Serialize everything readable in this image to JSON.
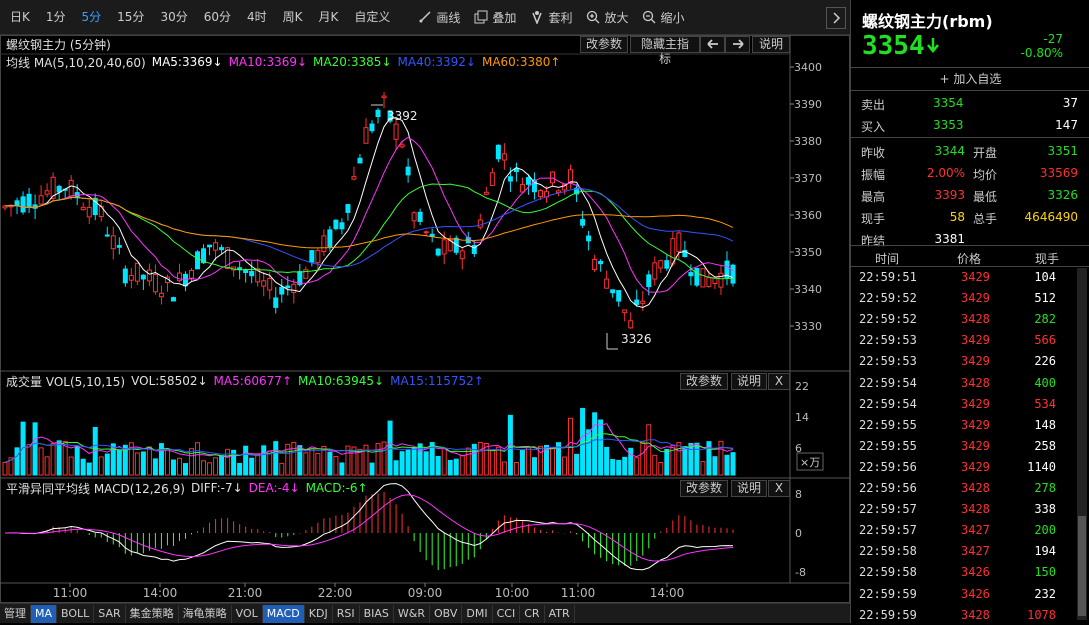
{
  "toolbar": {
    "periods": [
      "日K",
      "1分",
      "5分",
      "15分",
      "30分",
      "60分",
      "4时",
      "周K",
      "月K",
      "自定义"
    ],
    "active_period": "5分",
    "tools": [
      {
        "label": "画线",
        "icon": "draw-line-icon"
      },
      {
        "label": "叠加",
        "icon": "overlay-icon"
      },
      {
        "label": "套利",
        "icon": "arbitrage-icon"
      },
      {
        "label": "放大",
        "icon": "zoom-in-icon"
      },
      {
        "label": "缩小",
        "icon": "zoom-out-icon"
      }
    ]
  },
  "main_panel": {
    "title": "螺纹钢主力 (5分钟)",
    "buttons": [
      "改参数",
      "隐藏主指标",
      "说明"
    ],
    "indicator_line": [
      {
        "text": "均线 MA(5,10,20,40,60)",
        "color": "#e0e0e0"
      },
      {
        "text": "MA5:3369↓",
        "color": "#ffffff"
      },
      {
        "text": "MA10:3369↓",
        "color": "#ff33ff"
      },
      {
        "text": "MA20:3385↓",
        "color": "#33ff33"
      },
      {
        "text": "MA40:3392↓",
        "color": "#3355ff"
      },
      {
        "text": "MA60:3380↑",
        "color": "#ff9900"
      }
    ],
    "y_ticks": [
      "3400",
      "3390",
      "3380",
      "3370",
      "3360",
      "3350",
      "3340",
      "3330"
    ],
    "high_label": "3392",
    "low_label": "3326"
  },
  "volume_panel": {
    "indicator_line": [
      {
        "text": "成交量 VOL(5,10,15)",
        "color": "#e0e0e0"
      },
      {
        "text": "VOL:58502↓",
        "color": "#e0e0e0"
      },
      {
        "text": "MA5:60677↑",
        "color": "#ff33ff"
      },
      {
        "text": "MA10:63945↓",
        "color": "#33ff33"
      },
      {
        "text": "MA15:115752↑",
        "color": "#3355ff"
      }
    ],
    "buttons": [
      "改参数",
      "说明",
      "X"
    ],
    "y_ticks": [
      "22",
      "14",
      "6"
    ],
    "unit": "×万"
  },
  "macd_panel": {
    "indicator_line": [
      {
        "text": "平滑异同平均线 MACD(12,26,9)",
        "color": "#e0e0e0"
      },
      {
        "text": "DIFF:-7↓",
        "color": "#e0e0e0"
      },
      {
        "text": "DEA:-4↓",
        "color": "#ff33ff"
      },
      {
        "text": "MACD:-6↑",
        "color": "#33ff33"
      }
    ],
    "buttons": [
      "改参数",
      "说明",
      "X"
    ],
    "y_ticks": [
      "8",
      "0",
      "-8"
    ]
  },
  "x_axis": [
    "11:00",
    "14:00",
    "21:00",
    "22:00",
    "09:00",
    "10:00",
    "11:00",
    "14:00"
  ],
  "bottom_tabs": [
    "管理",
    "MA",
    "BOLL",
    "SAR",
    "集金策略",
    "海龟策略",
    "VOL",
    "MACD",
    "KDJ",
    "RSI",
    "BIAS",
    "W&R",
    "OBV",
    "DMI",
    "CCI",
    "CR",
    "ATR"
  ],
  "active_tabs": [
    "MA",
    "MACD"
  ],
  "quote": {
    "title": "螺纹钢主力(rbm)",
    "price": "3354",
    "change": "-27",
    "change_pct": "-0.80%",
    "add_watch": "加入自选",
    "sell": {
      "label": "卖出",
      "price": "3354",
      "vol": "37"
    },
    "buy": {
      "label": "买入",
      "price": "3353",
      "vol": "147"
    },
    "stats": [
      [
        {
          "l": "昨收",
          "v": "3344",
          "c": "grn"
        },
        {
          "l": "开盘",
          "v": "3351",
          "c": "grn"
        }
      ],
      [
        {
          "l": "振幅",
          "v": "2.00%",
          "c": "red"
        },
        {
          "l": "均价",
          "v": "33569",
          "c": "red"
        }
      ],
      [
        {
          "l": "最高",
          "v": "3393",
          "c": "red"
        },
        {
          "l": "最低",
          "v": "3326",
          "c": "grn"
        }
      ],
      [
        {
          "l": "现手",
          "v": "58",
          "c": "ylw"
        },
        {
          "l": "总手",
          "v": "4646490",
          "c": "ylw"
        }
      ],
      [
        {
          "l": "昨结",
          "v": "3381",
          "c": "wht"
        }
      ]
    ],
    "tick_headers": [
      "时间",
      "价格",
      "现手"
    ],
    "ticks": [
      [
        "22:59:51",
        "3429",
        "104",
        "wht"
      ],
      [
        "22:59:52",
        "3429",
        "512",
        "wht"
      ],
      [
        "22:59:52",
        "3428",
        "282",
        "grn"
      ],
      [
        "22:59:53",
        "3429",
        "566",
        "red"
      ],
      [
        "22:59:53",
        "3429",
        "226",
        "wht"
      ],
      [
        "22:59:54",
        "3428",
        "400",
        "grn"
      ],
      [
        "22:59:54",
        "3429",
        "534",
        "red"
      ],
      [
        "22:59:55",
        "3429",
        "148",
        "wht"
      ],
      [
        "22:59:55",
        "3429",
        "258",
        "wht"
      ],
      [
        "22:59:56",
        "3429",
        "1140",
        "wht"
      ],
      [
        "22:59:56",
        "3428",
        "278",
        "grn"
      ],
      [
        "22:59:57",
        "3428",
        "338",
        "wht"
      ],
      [
        "22:59:57",
        "3427",
        "200",
        "grn"
      ],
      [
        "22:59:58",
        "3427",
        "194",
        "wht"
      ],
      [
        "22:59:58",
        "3426",
        "150",
        "grn"
      ],
      [
        "22:59:59",
        "3426",
        "232",
        "wht"
      ],
      [
        "22:59:59",
        "3428",
        "1078",
        "red"
      ]
    ]
  },
  "colors": {
    "up": "#ff3030",
    "down": "#00e5ff",
    "green": "#20e020",
    "accent": "#38a0ff"
  }
}
